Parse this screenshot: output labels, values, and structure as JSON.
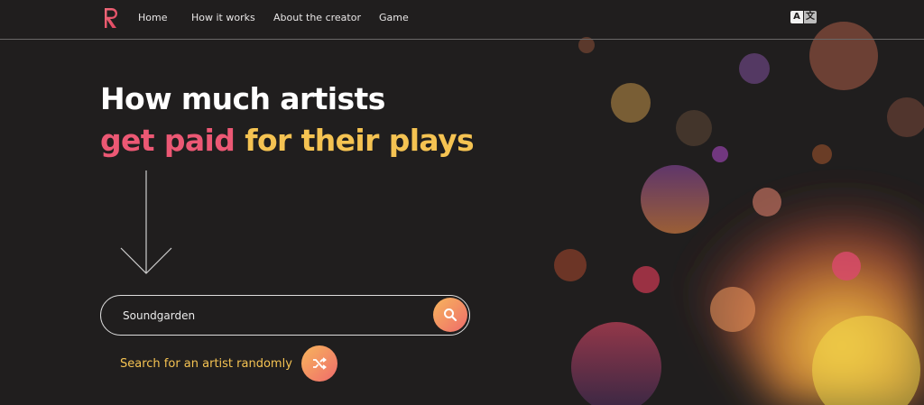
{
  "nav": {
    "items": [
      {
        "label": "Home"
      },
      {
        "label": "How it works"
      },
      {
        "label": "About the creator"
      },
      {
        "label": "Game"
      }
    ],
    "translate_icon": "translate-icon",
    "logo_icon": "logo-icon"
  },
  "hero": {
    "line1": "How much artists",
    "line2_pink": "get paid",
    "line2_yellow": "for their plays",
    "arrow_icon": "arrow-down-icon"
  },
  "search": {
    "value": "Soundgarden",
    "button_icon": "search-icon"
  },
  "random": {
    "label": "Search for an artist randomly",
    "icon": "shuffle-icon"
  },
  "colors": {
    "background": "#201e1e",
    "pink": "#ec5874",
    "yellow": "#f5c352",
    "gradient_start": "#f7b65c",
    "gradient_end": "#ef6b6b"
  }
}
